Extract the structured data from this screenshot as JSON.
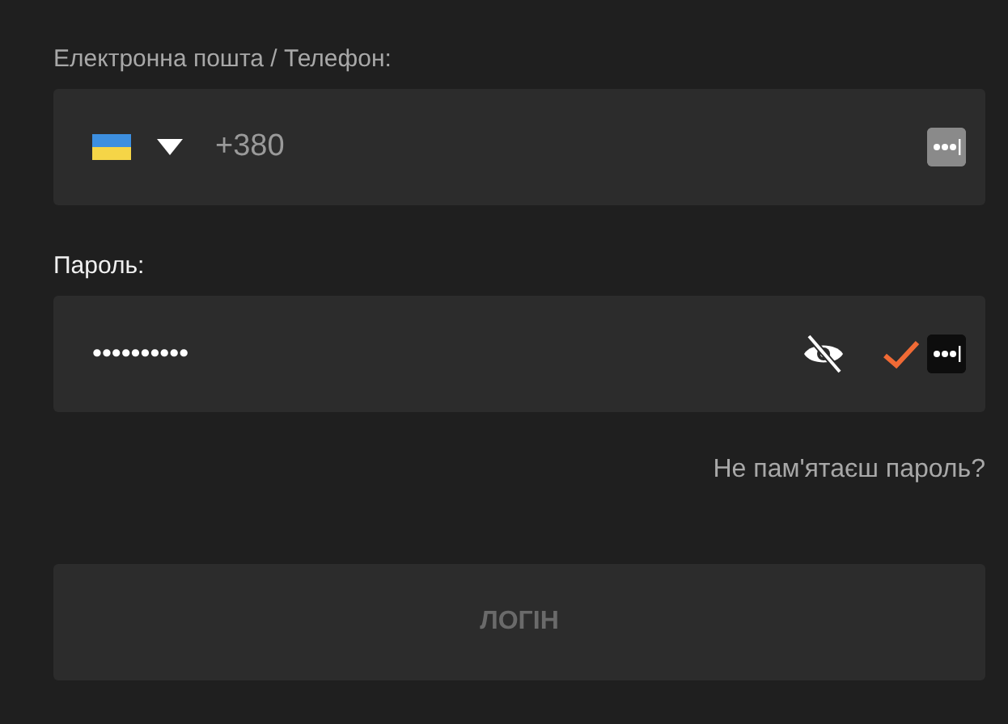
{
  "login_field": {
    "label": "Електронна пошта / Телефон:",
    "placeholder": "+380"
  },
  "password_field": {
    "label": "Пароль:",
    "value": "••••••••••",
    "revealed": false,
    "valid": true
  },
  "forgot_link": "Не пам'ятаєш пароль?",
  "login_button": {
    "label": "ЛОГІН",
    "disabled": true
  }
}
